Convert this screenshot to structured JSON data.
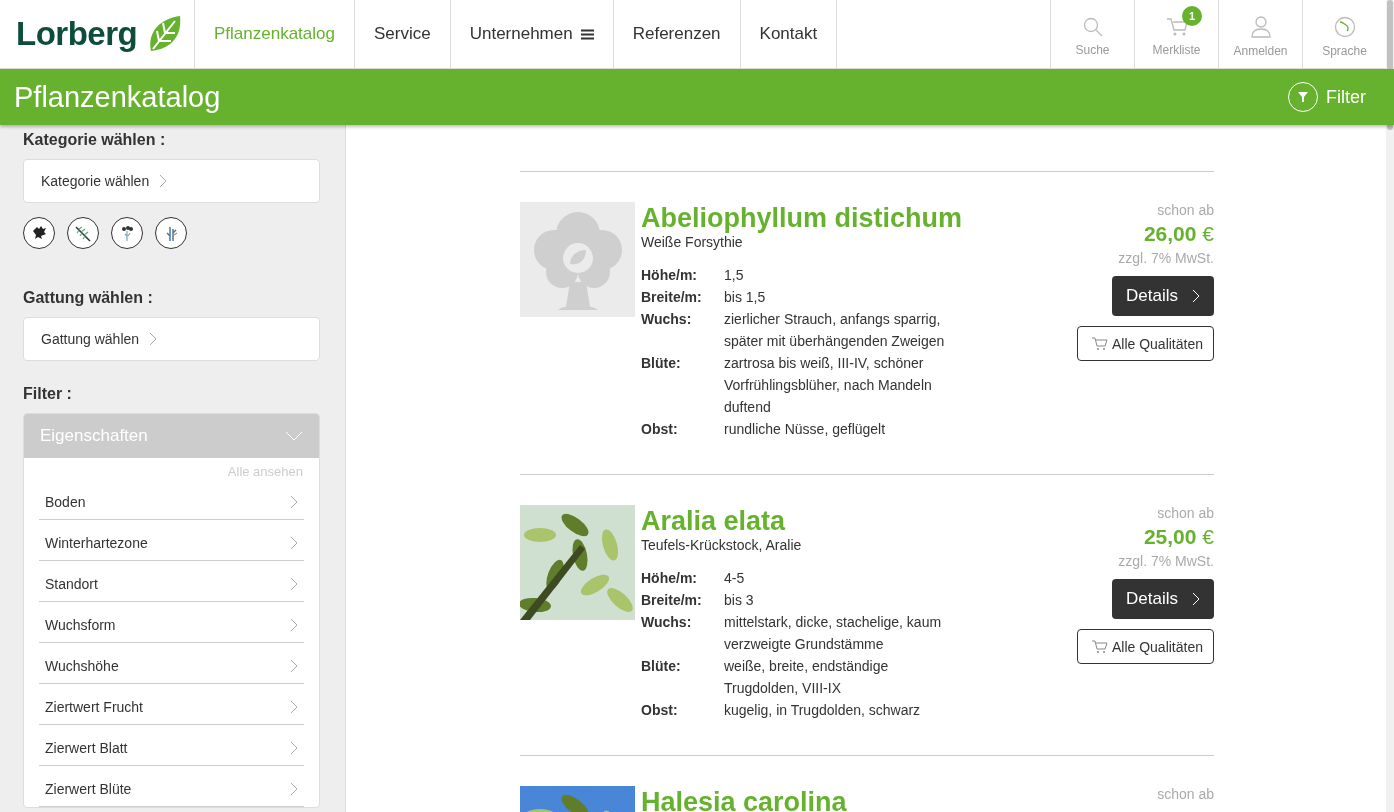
{
  "header": {
    "logo": "Lorberg",
    "nav": [
      {
        "label": "Pflanzenkatalog",
        "selected": true,
        "kind": "link"
      },
      {
        "label": "Service",
        "selected": false,
        "kind": "link"
      },
      {
        "label": "Unternehmen",
        "selected": false,
        "kind": "menu"
      },
      {
        "label": "Referenzen",
        "selected": false,
        "kind": "link"
      },
      {
        "label": "Kontakt",
        "selected": false,
        "kind": "link"
      }
    ],
    "tools": [
      {
        "label": "Suche",
        "kind": "search"
      },
      {
        "label": "Merkliste",
        "kind": "cart",
        "badge": "1"
      },
      {
        "label": "Anmelden",
        "kind": "user"
      },
      {
        "label": "Sprache",
        "kind": "globe"
      }
    ]
  },
  "title_bar": {
    "title": "Pflanzenkatalog",
    "filter_button": "Filter"
  },
  "sidebar": {
    "category_heading": "Kategorie wählen :",
    "category_select": "Kategorie wählen",
    "genus_heading": "Gattung wählen :",
    "genus_select": "Gattung wählen",
    "filter_heading": "Filter :",
    "accordion": {
      "title": "Eigenschaften",
      "expanded": true,
      "see_all": "Alle ansehen",
      "items": [
        "Boden",
        "Winterhartezone",
        "Standort",
        "Wuchsform",
        "Wuchshöhe",
        "Ziertwert Frucht",
        "Zierwert Blatt",
        "Zierwert Blüte"
      ]
    }
  },
  "products": [
    {
      "name": "Abeliophyllum distichum",
      "common_name": "Weiße Forsythie",
      "image": {
        "kind": "placeholder"
      },
      "price_label": "schon ab",
      "price": "26,00",
      "currency": "€",
      "tax_note": "zzgl. 7% MwSt.",
      "details_button": "Details",
      "qualities_button": "Alle Qualitäten",
      "properties": [
        {
          "label": "Höhe/m:",
          "value": "1,5"
        },
        {
          "label": "Breite/m:",
          "value": "bis 1,5"
        },
        {
          "label": "Wuchs:",
          "value": "zierlicher Strauch, anfangs sparrig, später mit überhängenden Zweigen"
        },
        {
          "label": "Blüte:",
          "value": "zartrosa bis weiß, III-IV, schöner Vorfrühlingsblüher, nach Mandeln duftend"
        },
        {
          "label": "Obst:",
          "value": "rundliche Nüsse, geflügelt"
        }
      ]
    },
    {
      "name": "Aralia elata",
      "common_name": "Teufels-Krückstock, Aralie",
      "price_label": "schon ab",
      "price": "25,00",
      "currency": "€",
      "tax_note": "zzgl. 7% MwSt.",
      "details_button": "Details",
      "qualities_button": "Alle Qualitäten",
      "properties": [
        {
          "label": "Höhe/m:",
          "value": "4-5"
        },
        {
          "label": "Breite/m:",
          "value": "bis 3"
        },
        {
          "label": "Wuchs:",
          "value": "mittelstark, dicke, stachelige, kaum verzweigte Grundstämme"
        },
        {
          "label": "Blüte:",
          "value": "weiße, breite, endständige Trugdolden, VIII-IX"
        },
        {
          "label": "Obst:",
          "value": "kugelig, in Trugdolden, schwarz"
        }
      ]
    },
    {
      "name": "Halesia carolina",
      "price_label": "schon ab"
    }
  ]
}
